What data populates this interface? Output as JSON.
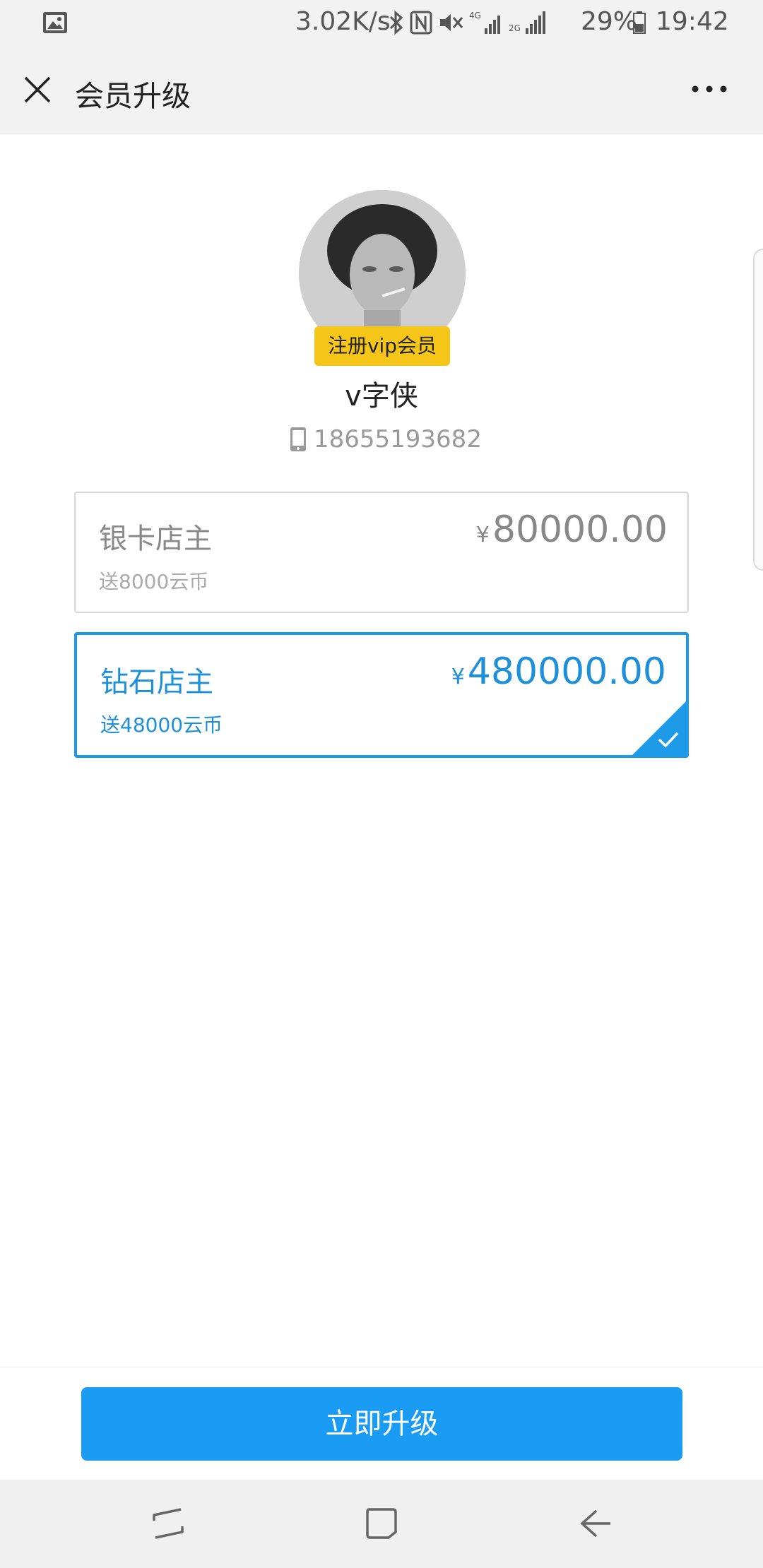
{
  "status_bar": {
    "network_speed": "3.02K/s",
    "battery_percent": "29%",
    "time": "19:42",
    "icons": [
      "image-icon",
      "bluetooth-icon",
      "nfc-icon",
      "mute-icon",
      "signal-4g-icon",
      "signal-2g-icon",
      "battery-icon"
    ]
  },
  "navbar": {
    "title": "会员升级",
    "close_icon": "close-icon",
    "more_icon": "more-icon"
  },
  "profile": {
    "vip_badge": "注册vip会员",
    "username": "v字侠",
    "phone": "18655193682"
  },
  "plans": [
    {
      "name": "银卡店主",
      "currency": "¥",
      "price": "80000.00",
      "bonus": "送8000云币",
      "selected": false
    },
    {
      "name": "钻石店主",
      "currency": "¥",
      "price": "480000.00",
      "bonus": "送48000云币",
      "selected": true
    }
  ],
  "action": {
    "upgrade_label": "立即升级"
  },
  "colors": {
    "accent": "#1a9bf4",
    "badge": "#f5c518",
    "selected_text": "#1e8fd9"
  },
  "system_nav": [
    "recents-icon",
    "home-icon",
    "back-icon"
  ]
}
